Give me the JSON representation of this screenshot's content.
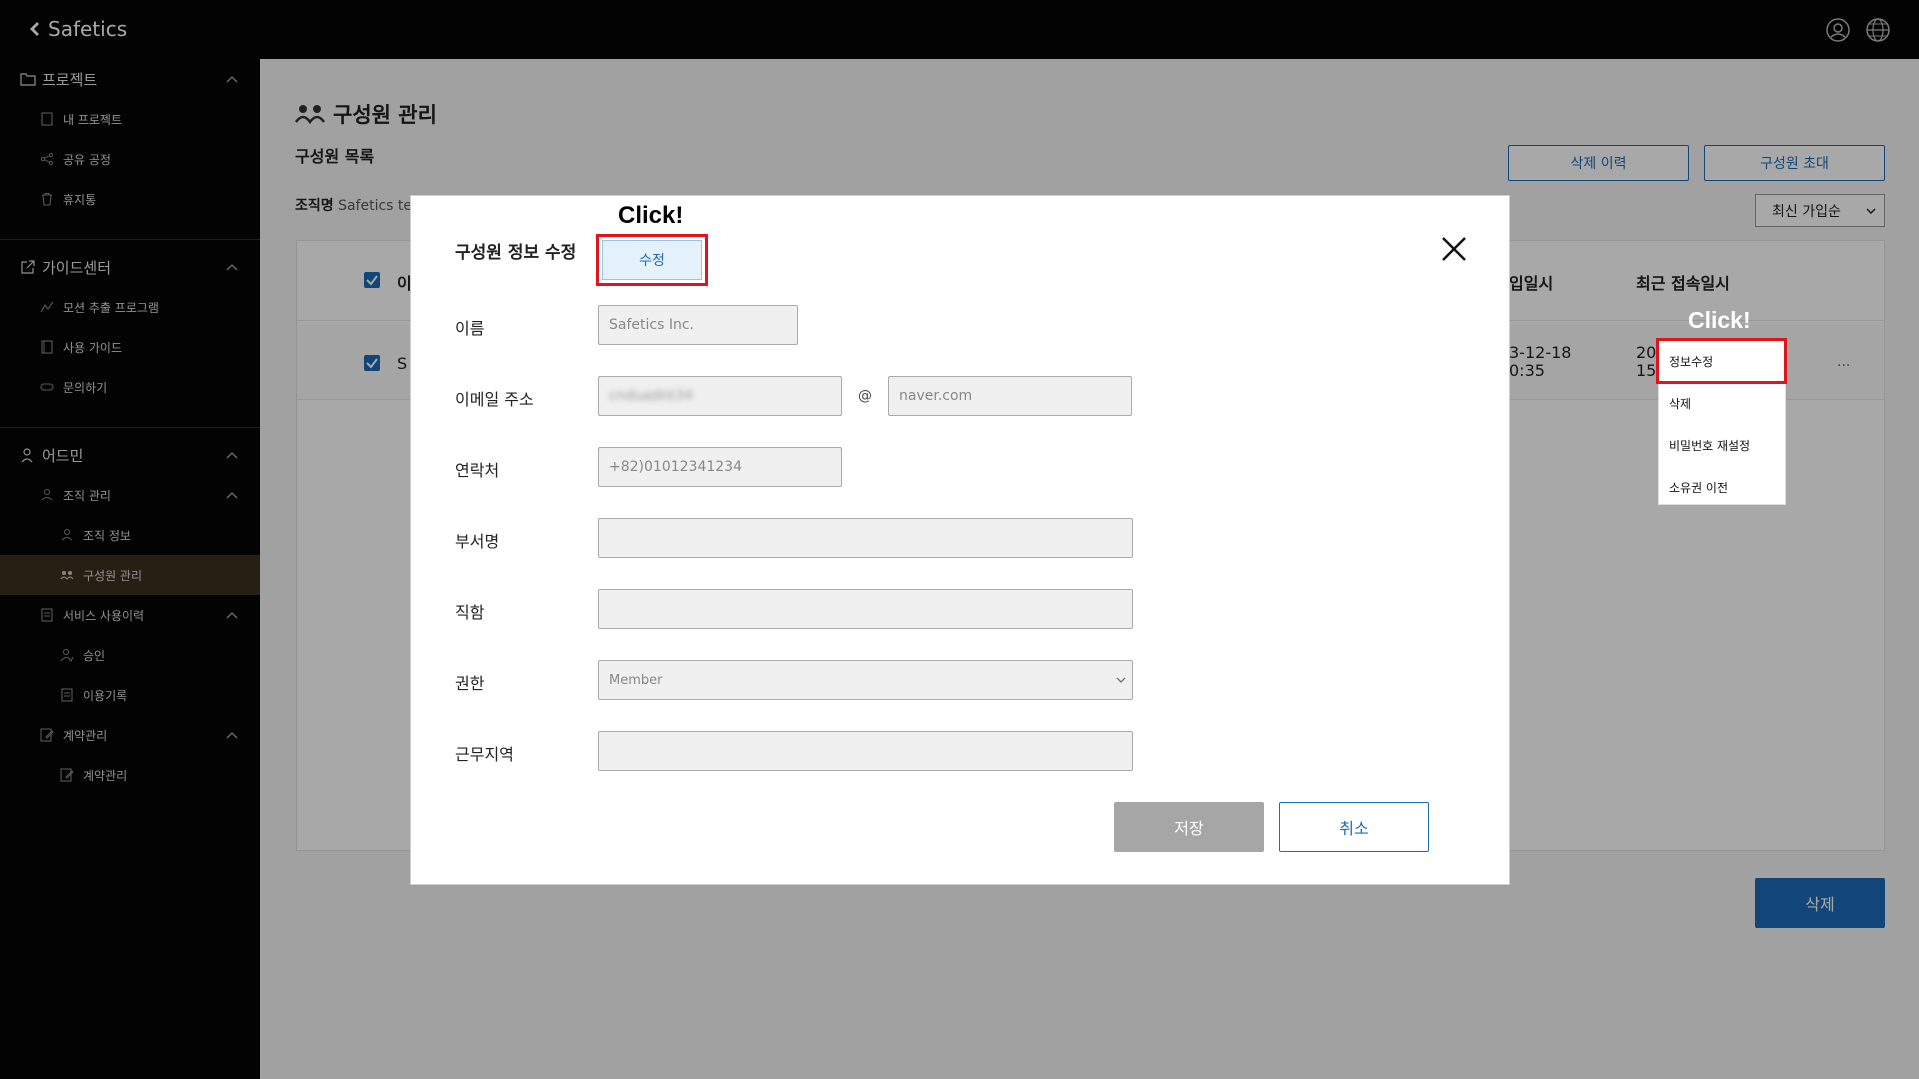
{
  "app": {
    "name": "Safetics"
  },
  "topbar": {
    "user_icon": "user-circle-icon",
    "lang_icon": "globe-icon"
  },
  "sidebar": {
    "project": {
      "label": "프로젝트",
      "items": [
        {
          "label": "내 프로젝트",
          "icon": "document-icon"
        },
        {
          "label": "공유 공정",
          "icon": "share-icon"
        },
        {
          "label": "휴지통",
          "icon": "trash-icon"
        }
      ]
    },
    "guide": {
      "label": "가이드센터",
      "items": [
        {
          "label": "모션 추출 프로그램",
          "icon": "motion-icon"
        },
        {
          "label": "사용 가이드",
          "icon": "book-icon"
        },
        {
          "label": "문의하기",
          "icon": "chat-icon"
        }
      ]
    },
    "admin": {
      "label": "어드민",
      "org": {
        "label": "조직 관리",
        "items": [
          {
            "label": "조직 정보"
          },
          {
            "label": "구성원 관리"
          }
        ]
      },
      "service": {
        "label": "서비스 사용이력",
        "items": [
          {
            "label": "승인"
          },
          {
            "label": "이용기록"
          }
        ]
      },
      "contract": {
        "label": "계약관리",
        "items": [
          {
            "label": "계약관리"
          }
        ]
      }
    }
  },
  "main": {
    "title": "구성원 관리",
    "subtitle": "구성원 목록",
    "org_label": "조직명",
    "org_value": "Safetics te",
    "delete_history": "삭제 이력",
    "invite_member": "구성원 초대",
    "sort": "최신 가입순",
    "table": {
      "col_name_partial": "이",
      "col_joined_partial": "입일시",
      "col_last_access": "최근 접속일시",
      "row": {
        "name_partial": "S",
        "joined_line1": "3-12-18",
        "joined_line2": "0:35",
        "last_line1": "20",
        "last_line2": "15",
        "more": "···"
      }
    },
    "delete_button": "삭제"
  },
  "context_menu": {
    "annotation": "Click!",
    "items": [
      "정보수정",
      "삭제",
      "비밀번호 재설정",
      "소유권 이전"
    ]
  },
  "modal": {
    "title": "구성원 정보 수정",
    "annotation": "Click!",
    "edit_button": "수정",
    "fields": {
      "name": {
        "label": "이름",
        "value": "Safetics Inc."
      },
      "email": {
        "label": "이메일 주소",
        "local": "cnduadnt34",
        "at": "@",
        "domain": "naver.com"
      },
      "phone": {
        "label": "연락처",
        "value": "+82)01012341234"
      },
      "department": {
        "label": "부서명",
        "value": ""
      },
      "position": {
        "label": "직함",
        "value": ""
      },
      "role": {
        "label": "권한",
        "value": "Member"
      },
      "region": {
        "label": "근무지역",
        "value": ""
      }
    },
    "save_button": "저장",
    "cancel_button": "취소"
  }
}
